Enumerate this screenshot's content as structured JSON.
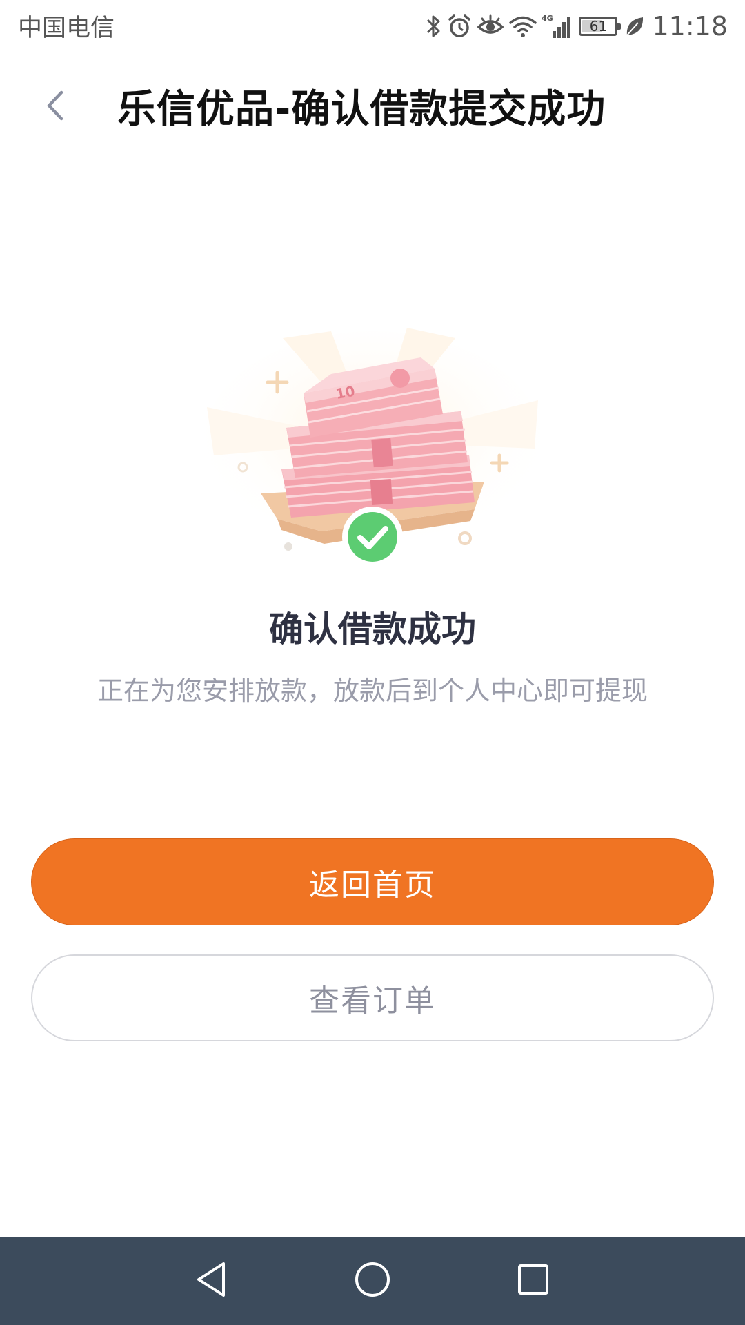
{
  "status_bar": {
    "carrier": "中国电信",
    "battery_level": "61",
    "time": "11:18",
    "network_type": "4G",
    "icons": [
      "bluetooth-icon",
      "alarm-icon",
      "eye-comfort-icon",
      "wifi-icon",
      "signal-icon",
      "battery-icon",
      "leaf-icon"
    ]
  },
  "header": {
    "back_icon": "chevron-left-icon",
    "title": "乐信优品-确认借款提交成功"
  },
  "result": {
    "illustration": "money-stack-success-illustration",
    "title": "确认借款成功",
    "subtitle": "正在为您安排放款，放款后到个人中心即可提现"
  },
  "actions": {
    "primary_label": "返回首页",
    "secondary_label": "查看订单"
  },
  "nav_bar": {
    "icons": [
      "back-triangle-icon",
      "home-circle-icon",
      "recents-square-icon"
    ]
  },
  "colors": {
    "accent": "#f07423",
    "success": "#5ccc72",
    "nav_bar": "#3c4b5c",
    "title_text": "#2e3142",
    "muted_text": "#9a9caa"
  }
}
